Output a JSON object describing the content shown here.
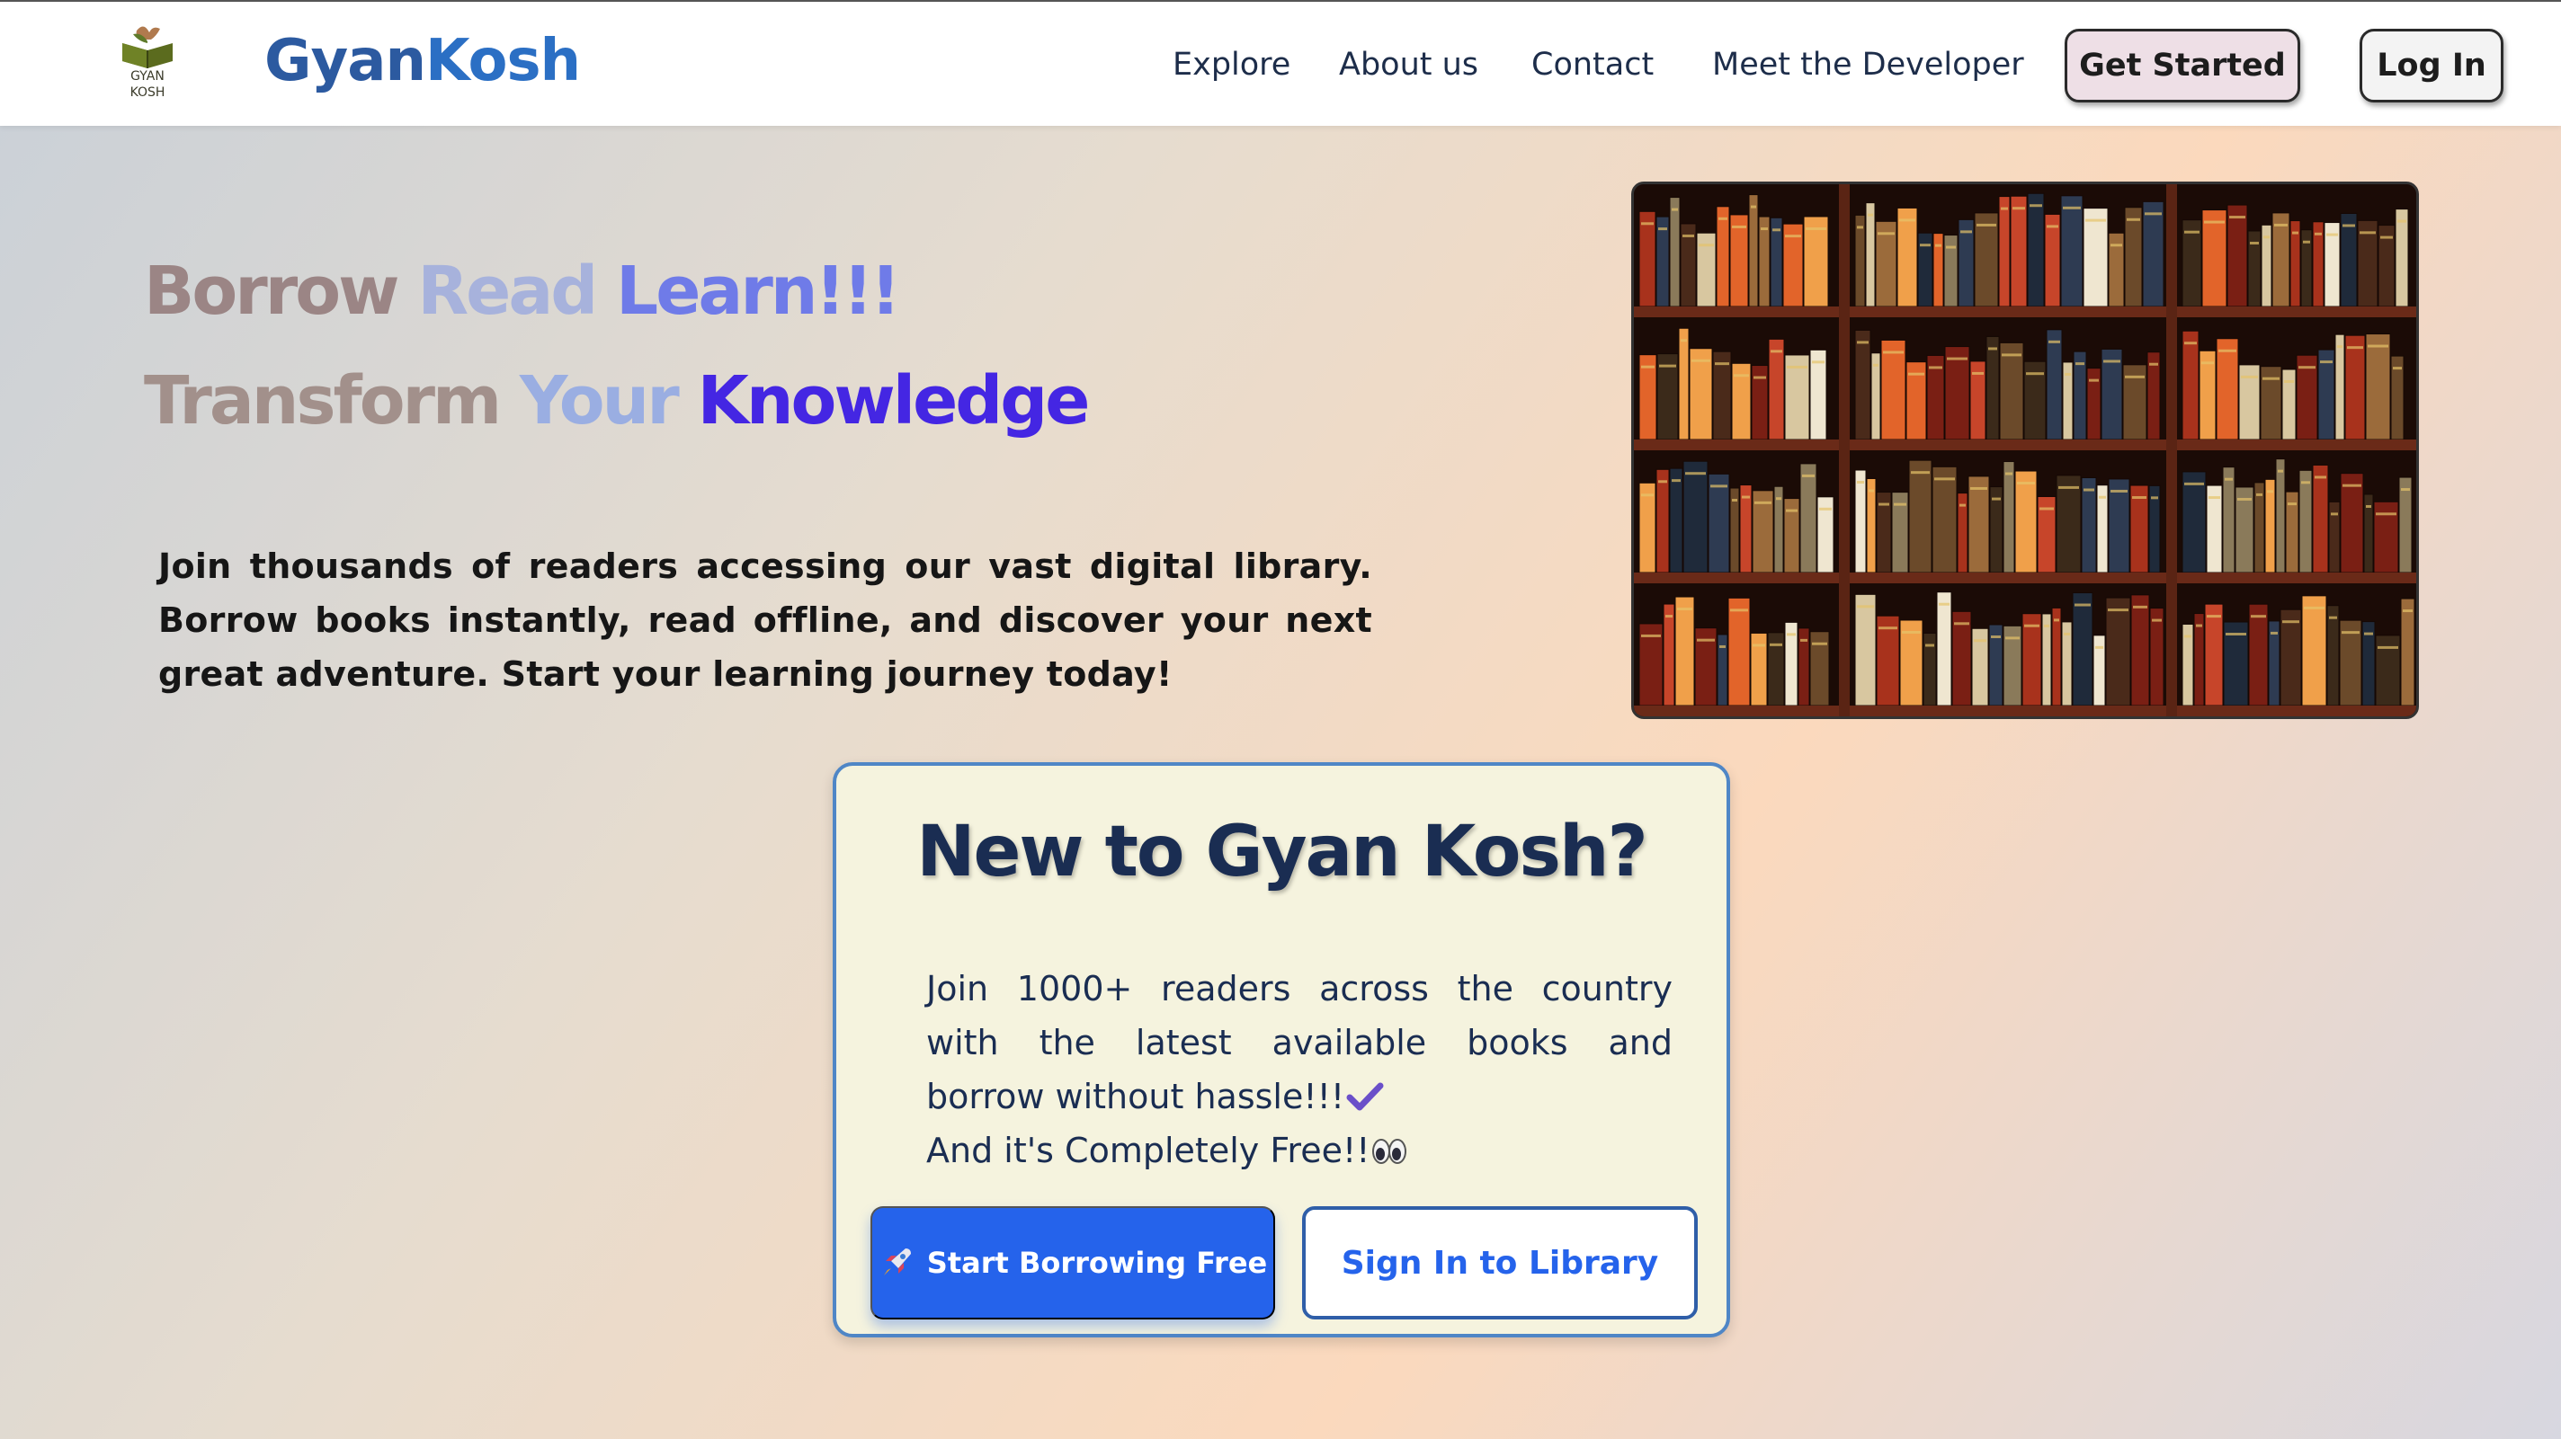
{
  "nav": {
    "logo_text_line1": "GYAN",
    "logo_text_line2": "KOSH",
    "brand_part1": "Gyan",
    "brand_part2": "Kosh",
    "links": [
      "Explore",
      "About us",
      "Contact",
      "Meet the Developer"
    ],
    "get_started_label": "Get Started",
    "login_label": "Log In"
  },
  "hero": {
    "title_line1": [
      "Borrow",
      "Read",
      "Learn!!!"
    ],
    "title_line2": [
      "Transform",
      "Your",
      "Knowledge"
    ],
    "description": "Join thousands of readers accessing our vast digital library. Borrow books instantly, read offline, and discover your next great adventure. Start your learning journey today!"
  },
  "card": {
    "title": "New to Gyan Kosh?",
    "text_line1": "Join 1000+ readers across the country",
    "text_line2": "with the latest available books and",
    "text_line3": "borrow without hassle!!!",
    "text_line4": "And it's Completely Free!!",
    "borrow_button_label": "Start Borrowing Free",
    "signin_button_label": "Sign In to Library"
  },
  "colors": {
    "brand": "#2c5aa0",
    "primary_button": "#2563eb",
    "card_border": "#4f86c6",
    "card_background": "#f5f3de"
  },
  "icons": {
    "logo": "book-plant-logo-icon",
    "check": "check-mark-icon",
    "eyes": "eyes-icon",
    "rocket": "rocket-icon"
  }
}
